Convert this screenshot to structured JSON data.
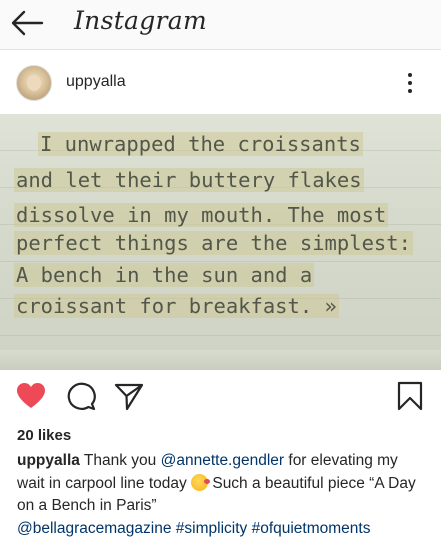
{
  "topbar": {
    "title": "Instagram"
  },
  "post": {
    "username": "uppyalla",
    "image_text_lines": [
      "I unwrapped the croissants",
      "and let their buttery flakes",
      "dissolve in my mouth. The most",
      "perfect things are the simplest:",
      "A bench in the sun and a",
      "croissant for breakfast. »"
    ],
    "likes": "20 likes",
    "caption": {
      "user": "uppyalla",
      "part1": "Thank you ",
      "mention1": "@annette.gendler",
      "part2": " for elevating my wait in carpool line today ",
      "part3": " Such a beautiful piece “A Day on a Bench in Paris”",
      "mention2": "@bellagracemagazine",
      "tag1": "#simplicity",
      "tag2": "#ofquietmoments"
    }
  },
  "icons": {
    "back": "back-arrow-icon",
    "more": "more-options-icon",
    "like": "heart-icon",
    "comment": "comment-icon",
    "share": "direct-share-icon",
    "save": "bookmark-icon",
    "emoji": "kissing-face-emoji"
  },
  "colors": {
    "like_red": "#ed4956",
    "link_blue": "#003569",
    "text": "#262626"
  }
}
